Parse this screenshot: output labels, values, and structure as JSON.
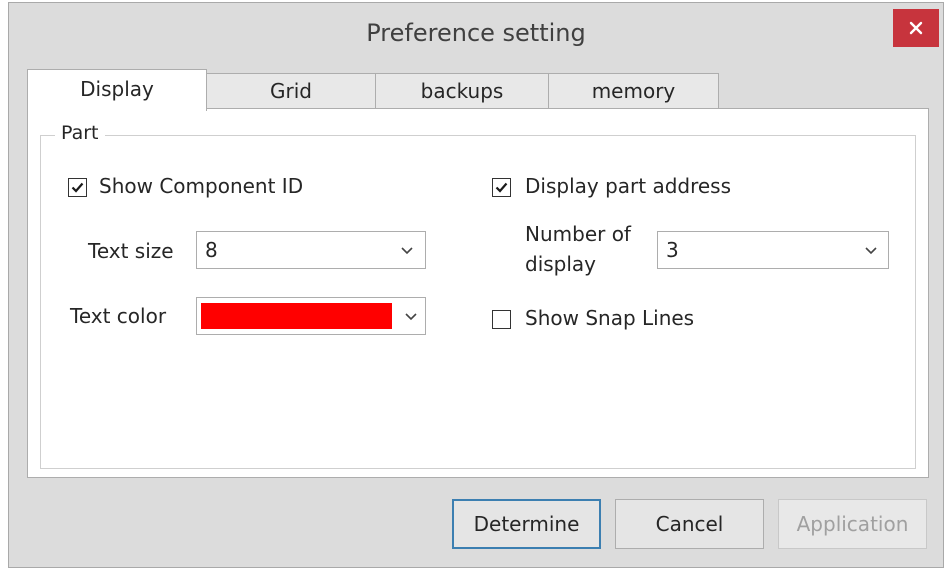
{
  "window": {
    "title": "Preference setting"
  },
  "tabs": [
    {
      "label": "Display",
      "active": true
    },
    {
      "label": "Grid",
      "active": false
    },
    {
      "label": "backups",
      "active": false
    },
    {
      "label": "memory",
      "active": false
    }
  ],
  "part_group": {
    "legend": "Part",
    "show_component_id": {
      "label": "Show Component ID",
      "checked": true
    },
    "text_size": {
      "label": "Text size",
      "value": "8"
    },
    "text_color": {
      "label": "Text color",
      "color": "#ff0000"
    },
    "display_part_address": {
      "label": "Display part address",
      "checked": true
    },
    "number_of_display": {
      "label_line1": "Number of",
      "label_line2": "display",
      "value": "3"
    },
    "show_snap_lines": {
      "label": "Show Snap Lines",
      "checked": false
    }
  },
  "buttons": {
    "determine": "Determine",
    "cancel": "Cancel",
    "application": "Application"
  },
  "icons": {
    "close": "close-icon",
    "checkmark": "checkmark-icon",
    "dropdown": "chevron-down-icon"
  },
  "colors": {
    "close_button": "#c7343d",
    "default_button_border": "#3c7fb1",
    "window_background": "#dcdcdc"
  }
}
